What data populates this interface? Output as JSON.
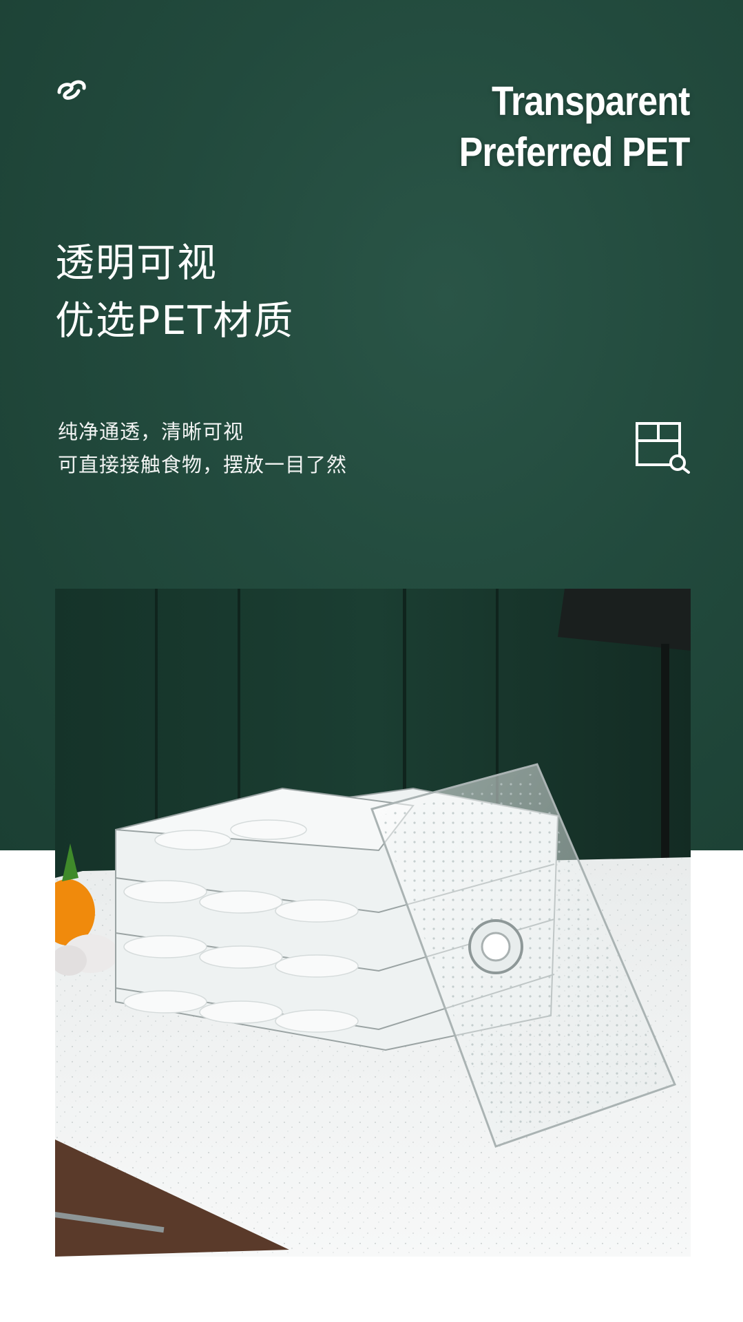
{
  "header": {
    "brand_icon": "brand-logo-icon",
    "title_en_line1": "Transparent",
    "title_en_line2": "Preferred PET"
  },
  "feature": {
    "title_cn_line1": "透明可视",
    "title_cn_line2": "优选PET材质",
    "desc_line1": "纯净通透，清晰可视",
    "desc_line2": "可直接接触食物，摆放一目了然",
    "icon": "window-magnifier-icon"
  },
  "photo": {
    "subject": "product-photo"
  },
  "colors": {
    "panel_green": "#224a3d",
    "text_white": "#ffffff",
    "page_background": "#ffffff"
  }
}
